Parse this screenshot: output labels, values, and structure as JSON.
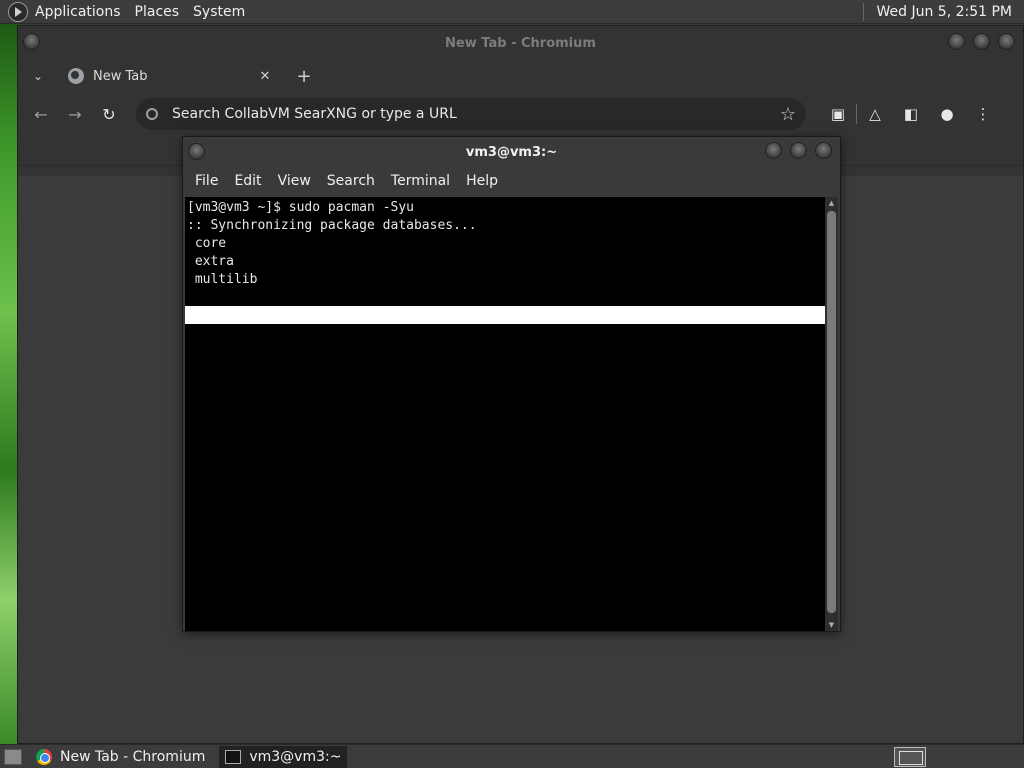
{
  "top_panel": {
    "menus": [
      "Applications",
      "Places",
      "System"
    ],
    "clock": "Wed Jun  5,  2:51 PM"
  },
  "chromium": {
    "window_title": "New Tab - Chromium",
    "tab_title": "New Tab",
    "omnibox_placeholder": "Search CollabVM SearXNG or type a URL"
  },
  "terminal": {
    "window_title": "vm3@vm3:~",
    "menu": [
      "File",
      "Edit",
      "View",
      "Search",
      "Terminal",
      "Help"
    ],
    "lines": [
      "[vm3@vm3 ~]$ sudo pacman -Syu",
      ":: Synchronizing package databases...",
      " core",
      " extra",
      " multilib"
    ]
  },
  "taskbar": {
    "items": [
      "New Tab - Chromium",
      "vm3@vm3:~"
    ]
  },
  "icons": {
    "chromium_tab_favicon": "globe-icon",
    "omnibox": "tune-icon",
    "bookmark": "star-icon"
  }
}
